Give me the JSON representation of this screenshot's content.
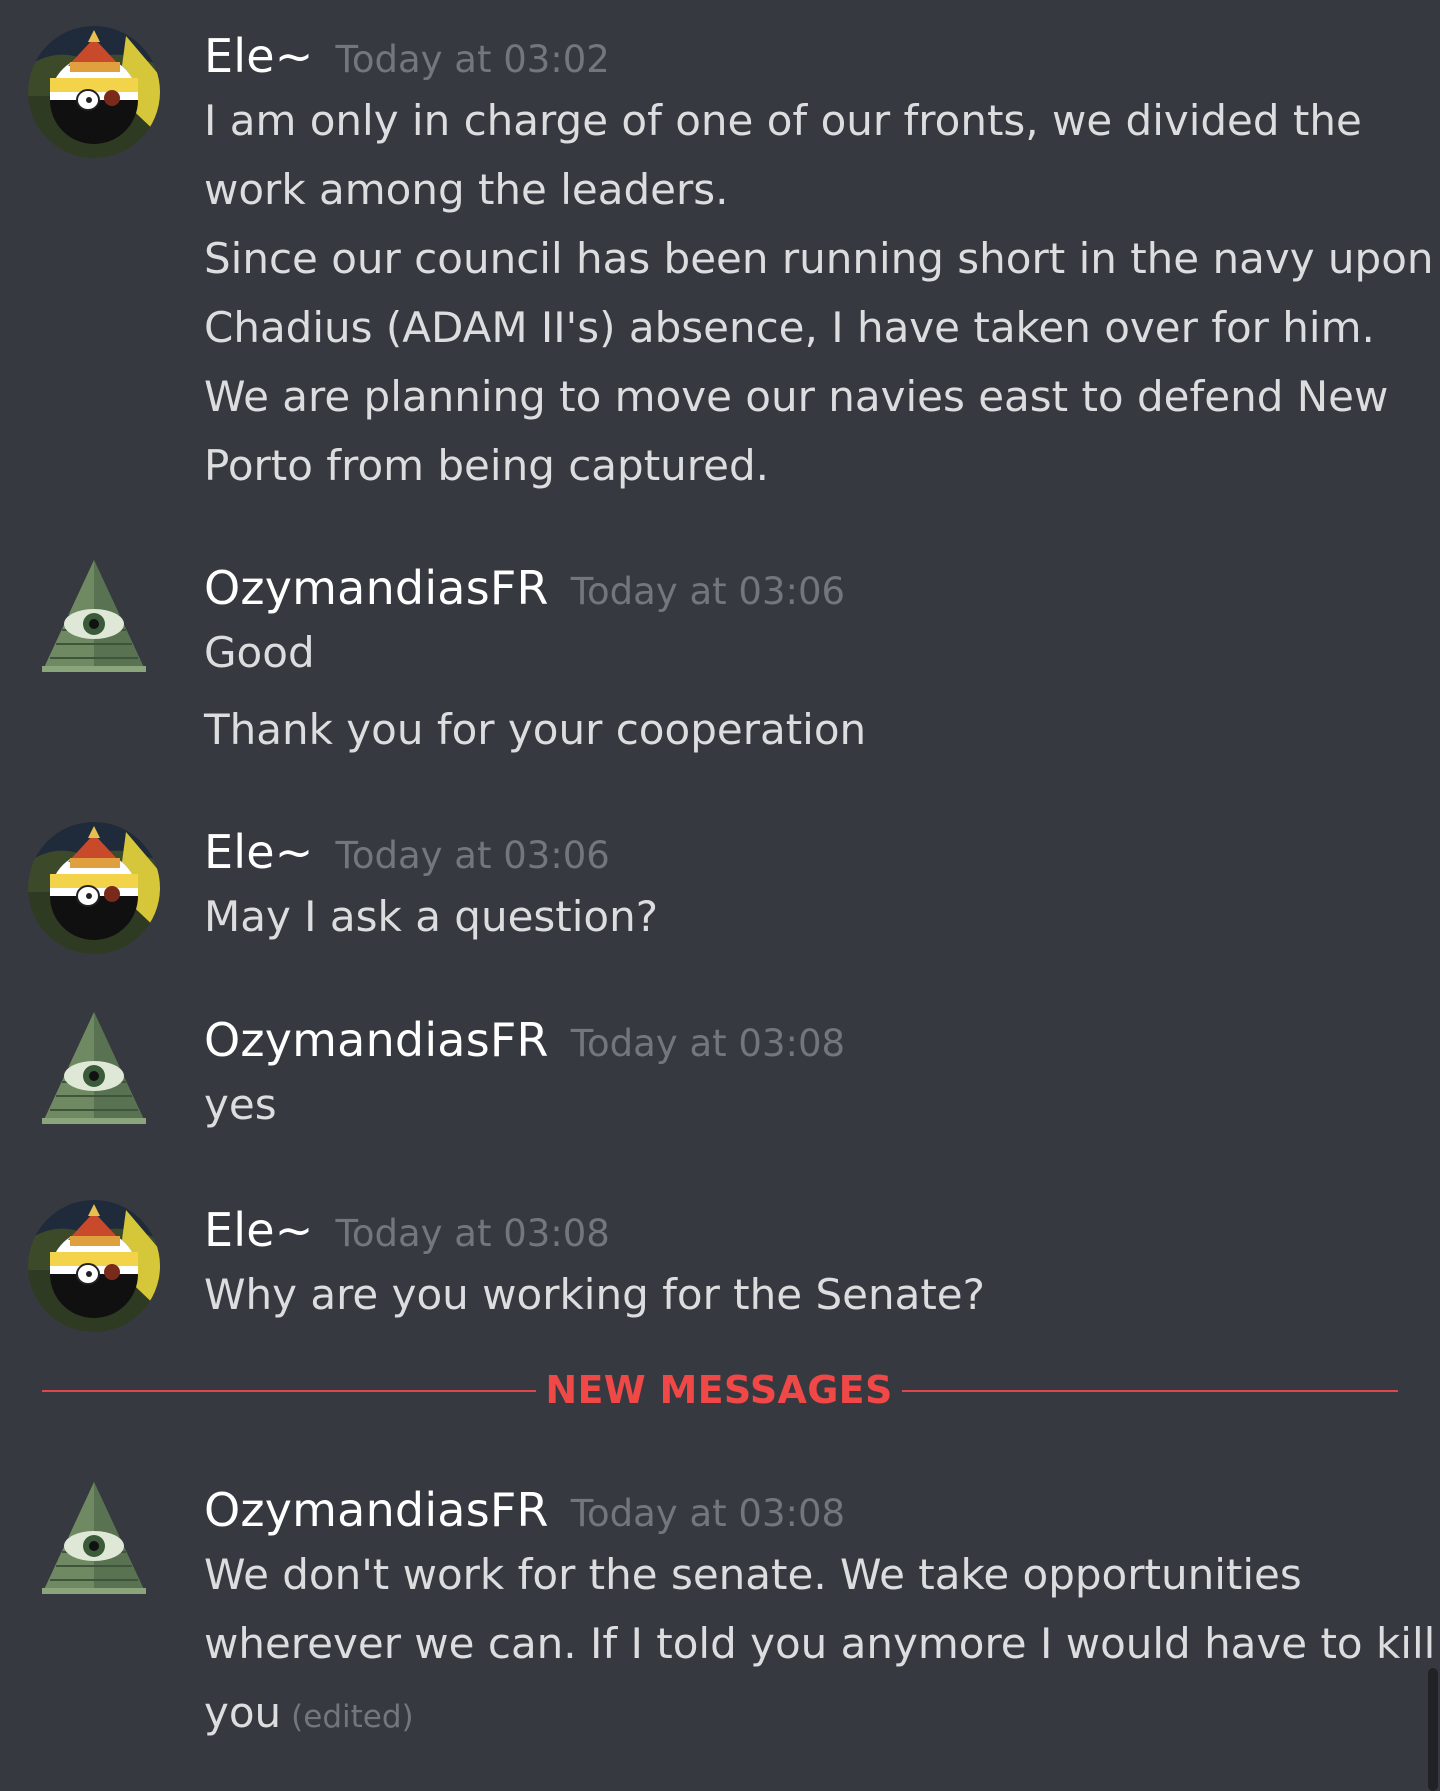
{
  "chat": {
    "messages": [
      {
        "author": "Ele~",
        "avatar": "ele-avatar-icon",
        "timestamp": "Today at 03:02",
        "lines": [
          "I am only in charge of one of our fronts, we divided the",
          "work among the leaders.",
          "Since our council has been running short in the navy upon",
          "Chadius (ADAM II's) absence, I have taken over for him.",
          "We are planning to move our navies east to defend New",
          "Porto from being captured."
        ]
      },
      {
        "author": "OzymandiasFR",
        "avatar": "pyramid-eye-icon",
        "timestamp": "Today at 03:06",
        "lines": [
          "Good",
          "Thank you for your cooperation"
        ]
      },
      {
        "author": "Ele~",
        "avatar": "ele-avatar-icon",
        "timestamp": "Today at 03:06",
        "lines": [
          "May I ask a question?"
        ]
      },
      {
        "author": "OzymandiasFR",
        "avatar": "pyramid-eye-icon",
        "timestamp": "Today at 03:08",
        "lines": [
          "yes"
        ]
      },
      {
        "author": "Ele~",
        "avatar": "ele-avatar-icon",
        "timestamp": "Today at 03:08",
        "lines": [
          "Why are you working for the Senate?"
        ]
      },
      {
        "author": "OzymandiasFR",
        "avatar": "pyramid-eye-icon",
        "timestamp": "Today at 03:08",
        "lines": [
          "We don't work for the senate. We take opportunities",
          "wherever we can. If I told you anymore I would have to kill",
          "you"
        ],
        "edited_label": "(edited)"
      }
    ],
    "new_messages_divider": "NEW MESSAGES"
  },
  "colors": {
    "background": "#36393f",
    "username": "#ffffff",
    "message_text": "#dcddde",
    "timestamp": "#72767d",
    "divider": "#f04747"
  }
}
